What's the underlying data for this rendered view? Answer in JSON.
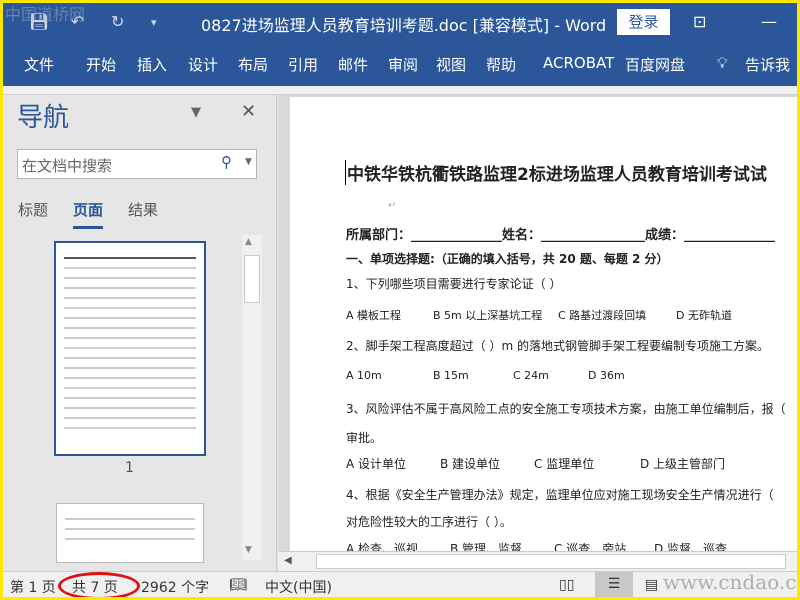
{
  "titlebar": {
    "quick_access": [
      "save-icon",
      "undo-icon",
      "redo-icon",
      "customize-icon"
    ],
    "title": "0827进场监理人员教育培训考题.doc [兼容模式]  -  Word",
    "login": "登录"
  },
  "ribbon": {
    "tabs": [
      "文件",
      "开始",
      "插入",
      "设计",
      "布局",
      "引用",
      "邮件",
      "审阅",
      "视图",
      "帮助",
      "ACROBAT",
      "百度网盘"
    ],
    "tell_me": "告诉我"
  },
  "nav": {
    "heading": "导航",
    "search_placeholder": "在文档中搜索",
    "tabs": [
      "标题",
      "页面",
      "结果"
    ],
    "active_tab": "页面",
    "page_label": "1"
  },
  "document": {
    "title": "中铁华铁杭衢铁路监理2标进场监理人员教育培训考试试",
    "form": "所属部门：______________姓名：________________成绩：______________",
    "section": "一、单项选择题:（正确的填入括号，共 20 题、每题 2 分）",
    "questions": [
      {
        "text": "1、下列哪些项目需要进行专家论证（          ）",
        "options": [
          "A  模板工程",
          "B 5m 以上深基坑工程",
          "C  路基过渡段回填",
          "D  无砟轨道"
        ]
      },
      {
        "text": "2、脚手架工程高度超过（      ）m 的落地式钢管脚手架工程要编制专项施工方案。",
        "options": [
          "A 10m",
          "B 15m",
          "C 24m",
          "D 36m"
        ]
      },
      {
        "text": "3、风险评估不属于高风险工点的安全施工专项技术方案，由施工单位编制后，报（",
        "text2": "审批。",
        "options": [
          "A  设计单位",
          "B 建设单位",
          "C 监理单位",
          "D 上级主管部门"
        ]
      },
      {
        "text": "4、根据《安全生产管理办法》规定，监理单位应对施工现场安全生产情况进行（",
        "text2": "对危险性较大的工序进行（      ）。",
        "options": [
          "A 检查、巡视",
          "B 管理、监督",
          "C 巡查、旁站",
          "D 监督、巡查"
        ]
      }
    ]
  },
  "status": {
    "page": "第 1 页",
    "total": "共 7 页",
    "words": "2962 个字",
    "language": "中文(中国)"
  },
  "watermarks": {
    "top": "中国道桥网",
    "bottom": "www.cndao.com"
  }
}
